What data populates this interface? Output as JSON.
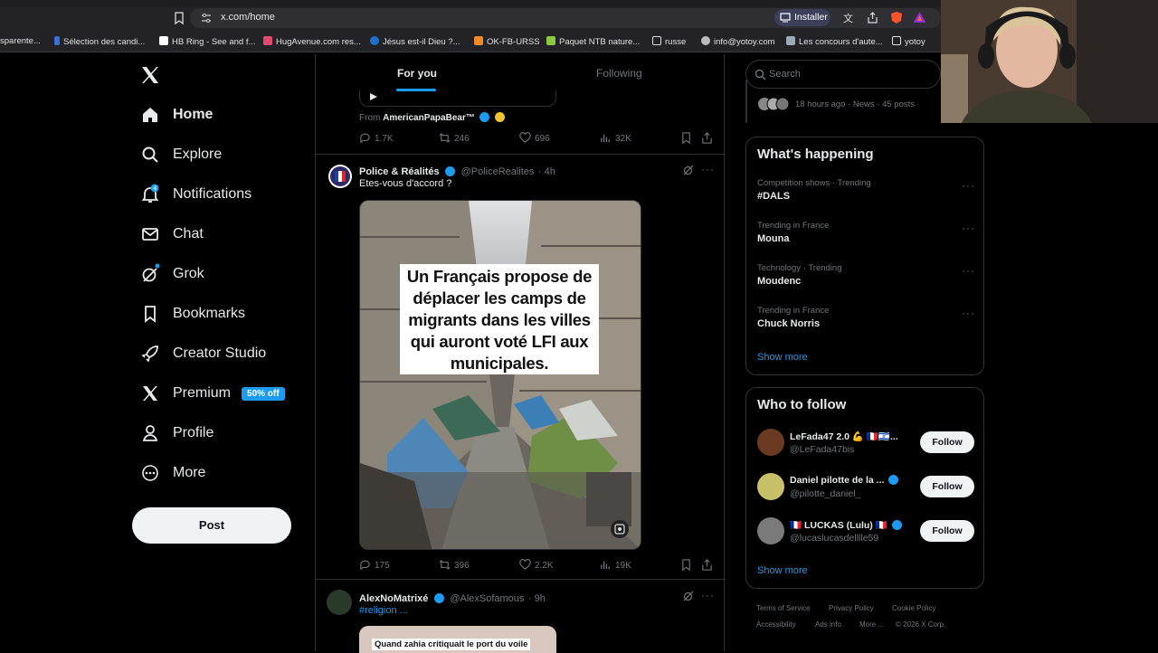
{
  "browser": {
    "url": "x.com/home",
    "install_label": "Installer",
    "bookmarks": [
      "sparente...",
      "Sélection des candi...",
      "HB Ring - See and f...",
      "HugAvenue.com res...",
      "Jésus est-il Dieu ?...",
      "OK-FB-URSS",
      "Paquet NTB nature...",
      "russe",
      "info@yotoy.com",
      "Les concours d'aute...",
      "yotoy"
    ]
  },
  "nav": {
    "items": [
      {
        "label": "Home",
        "icon": "home-icon"
      },
      {
        "label": "Explore",
        "icon": "search-icon"
      },
      {
        "label": "Notifications",
        "icon": "bell-icon",
        "badge": "4"
      },
      {
        "label": "Chat",
        "icon": "mail-icon"
      },
      {
        "label": "Grok",
        "icon": "grok-icon"
      },
      {
        "label": "Bookmarks",
        "icon": "bookmark-icon"
      },
      {
        "label": "Creator Studio",
        "icon": "rocket-icon"
      },
      {
        "label": "Premium",
        "icon": "x-logo-icon"
      },
      {
        "label": "Profile",
        "icon": "person-icon"
      },
      {
        "label": "More",
        "icon": "more-circle-icon"
      }
    ],
    "premium_badge": "50% off",
    "post_label": "Post"
  },
  "timeline": {
    "tabs": [
      "For you",
      "Following"
    ],
    "tweet_top": {
      "from_prefix": "From",
      "from_name": "AmericanPapaBear™",
      "replies": "1.7K",
      "retweets": "246",
      "likes": "696",
      "views": "32K"
    },
    "tweet_main": {
      "name": "Police & Réalités",
      "handle": "@PoliceRealites",
      "time": "· 4h",
      "text": "Etes-vous d'accord ?",
      "image_text": "Un Français propose de déplacer les camps de migrants dans les villes qui auront voté LFI aux municipales.",
      "replies": "175",
      "retweets": "396",
      "likes": "2.2K",
      "views": "19K"
    },
    "tweet_next": {
      "name": "AlexNoMatrixé",
      "handle": "@AlexSofamous",
      "time": "· 9h",
      "text": "#religion ...",
      "image_caption": "Quand zahia critiquait le port du voile"
    }
  },
  "right": {
    "search_placeholder": "Search",
    "news_meta": "18 hours ago · News · 45 posts",
    "happening_title": "What's happening",
    "trends": [
      {
        "meta": "Competition shows · Trending",
        "name": "#DALS"
      },
      {
        "meta": "Trending in France",
        "name": "Mouna"
      },
      {
        "meta": "Technology · Trending",
        "name": "Moudenc"
      },
      {
        "meta": "Trending in France",
        "name": "Chuck Norris"
      }
    ],
    "show_more": "Show more",
    "follow_title": "Who to follow",
    "follow": [
      {
        "name": "LeFada47 2.0 💪 🇫🇷🇮🇱...",
        "handle": "@LeFada47bis"
      },
      {
        "name": "Daniel pilotte de la ...",
        "handle": "@pilotte_daniel_"
      },
      {
        "name": "🇫🇷 LUCKAS (Lulu) 🇫🇷",
        "handle": "@lucaslucasdelllle59"
      }
    ],
    "follow_label": "Follow",
    "footer": [
      "Terms of Service",
      "Privacy Policy",
      "Cookie Policy",
      "Accessibility",
      "Ads info",
      "More ...",
      "© 2026 X Corp."
    ]
  }
}
